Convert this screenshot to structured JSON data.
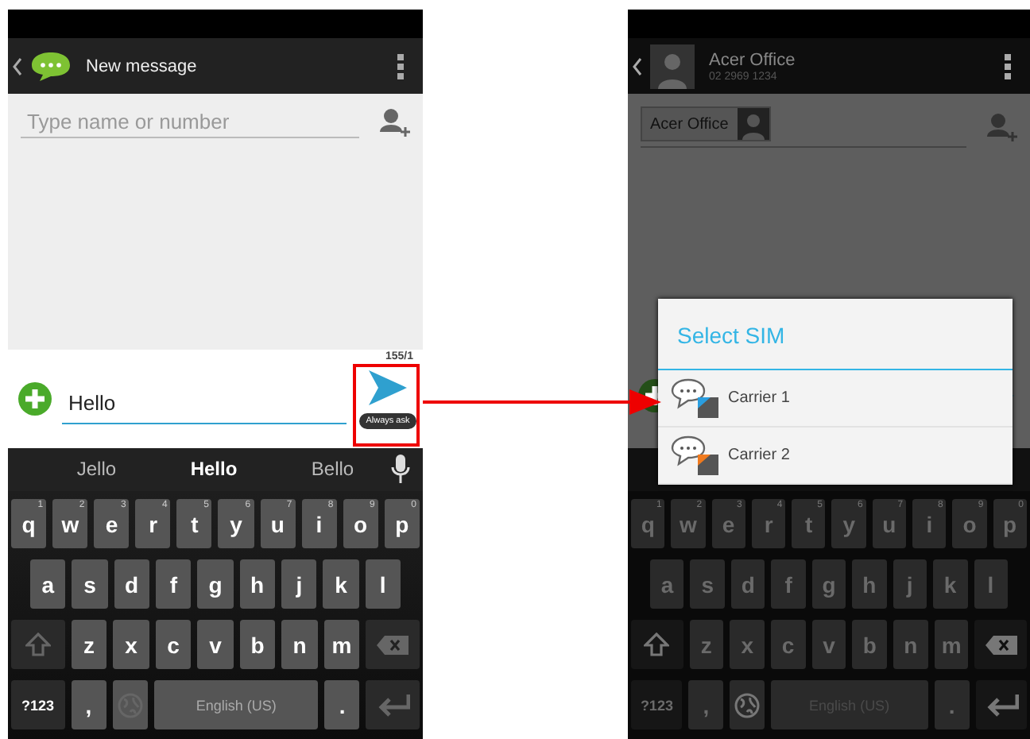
{
  "phones": [
    {
      "dimmed": false,
      "header": {
        "kind": "app",
        "title": "New message"
      },
      "recipient": {
        "kind": "field",
        "placeholder": "Type name or number"
      },
      "compose": {
        "counter": "155/1",
        "message": "Hello",
        "tooltip": "Always ask",
        "highlighted": true
      },
      "suggestions": [
        {
          "text": "Jello",
          "selected": false
        },
        {
          "text": "Hello",
          "selected": true
        },
        {
          "text": "Bello",
          "selected": false
        }
      ],
      "keyboard": [
        [
          {
            "kind": "letter",
            "label": "q",
            "hint": "1"
          },
          {
            "kind": "letter",
            "label": "w",
            "hint": "2"
          },
          {
            "kind": "letter",
            "label": "e",
            "hint": "3"
          },
          {
            "kind": "letter",
            "label": "r",
            "hint": "4"
          },
          {
            "kind": "letter",
            "label": "t",
            "hint": "5"
          },
          {
            "kind": "letter",
            "label": "y",
            "hint": "6"
          },
          {
            "kind": "letter",
            "label": "u",
            "hint": "7"
          },
          {
            "kind": "letter",
            "label": "i",
            "hint": "8"
          },
          {
            "kind": "letter",
            "label": "o",
            "hint": "9"
          },
          {
            "kind": "letter",
            "label": "p",
            "hint": "0"
          }
        ],
        [
          {
            "kind": "letter",
            "label": "a"
          },
          {
            "kind": "letter",
            "label": "s"
          },
          {
            "kind": "letter",
            "label": "d"
          },
          {
            "kind": "letter",
            "label": "f"
          },
          {
            "kind": "letter",
            "label": "g"
          },
          {
            "kind": "letter",
            "label": "h"
          },
          {
            "kind": "letter",
            "label": "j"
          },
          {
            "kind": "letter",
            "label": "k"
          },
          {
            "kind": "letter",
            "label": "l"
          }
        ],
        [
          {
            "kind": "shift"
          },
          {
            "kind": "letter",
            "label": "z"
          },
          {
            "kind": "letter",
            "label": "x"
          },
          {
            "kind": "letter",
            "label": "c"
          },
          {
            "kind": "letter",
            "label": "v"
          },
          {
            "kind": "letter",
            "label": "b"
          },
          {
            "kind": "letter",
            "label": "n"
          },
          {
            "kind": "letter",
            "label": "m"
          },
          {
            "kind": "backspace"
          }
        ],
        [
          {
            "kind": "symbol",
            "label": "?123"
          },
          {
            "kind": "letter",
            "label": ","
          },
          {
            "kind": "globe"
          },
          {
            "kind": "space",
            "label": "English (US)"
          },
          {
            "kind": "letter",
            "label": "."
          },
          {
            "kind": "enter"
          }
        ]
      ]
    },
    {
      "dimmed": true,
      "header": {
        "kind": "contact",
        "title": "Acer Office",
        "subtitle": "02 2969 1234"
      },
      "recipient": {
        "kind": "chip",
        "name": "Acer Office"
      },
      "keyboard": [
        [
          {
            "kind": "letter",
            "label": "q",
            "hint": "1"
          },
          {
            "kind": "letter",
            "label": "w",
            "hint": "2"
          },
          {
            "kind": "letter",
            "label": "e",
            "hint": "3"
          },
          {
            "kind": "letter",
            "label": "r",
            "hint": "4"
          },
          {
            "kind": "letter",
            "label": "t",
            "hint": "5"
          },
          {
            "kind": "letter",
            "label": "y",
            "hint": "6"
          },
          {
            "kind": "letter",
            "label": "u",
            "hint": "7"
          },
          {
            "kind": "letter",
            "label": "i",
            "hint": "8"
          },
          {
            "kind": "letter",
            "label": "o",
            "hint": "9"
          },
          {
            "kind": "letter",
            "label": "p",
            "hint": "0"
          }
        ],
        [
          {
            "kind": "letter",
            "label": "a"
          },
          {
            "kind": "letter",
            "label": "s"
          },
          {
            "kind": "letter",
            "label": "d"
          },
          {
            "kind": "letter",
            "label": "f"
          },
          {
            "kind": "letter",
            "label": "g"
          },
          {
            "kind": "letter",
            "label": "h"
          },
          {
            "kind": "letter",
            "label": "j"
          },
          {
            "kind": "letter",
            "label": "k"
          },
          {
            "kind": "letter",
            "label": "l"
          }
        ],
        [
          {
            "kind": "shift"
          },
          {
            "kind": "letter",
            "label": "z"
          },
          {
            "kind": "letter",
            "label": "x"
          },
          {
            "kind": "letter",
            "label": "c"
          },
          {
            "kind": "letter",
            "label": "v"
          },
          {
            "kind": "letter",
            "label": "b"
          },
          {
            "kind": "letter",
            "label": "n"
          },
          {
            "kind": "letter",
            "label": "m"
          },
          {
            "kind": "backspace"
          }
        ],
        [
          {
            "kind": "symbol",
            "label": "?123"
          },
          {
            "kind": "letter",
            "label": ","
          },
          {
            "kind": "globe"
          },
          {
            "kind": "space",
            "label": "English (US)"
          },
          {
            "kind": "letter",
            "label": "."
          },
          {
            "kind": "enter"
          }
        ]
      ],
      "dialog": {
        "title": "Select SIM",
        "items": [
          {
            "label": "Carrier 1",
            "color": "#2a9ee0"
          },
          {
            "label": "Carrier 2",
            "color": "#f07a1e"
          }
        ]
      }
    }
  ]
}
